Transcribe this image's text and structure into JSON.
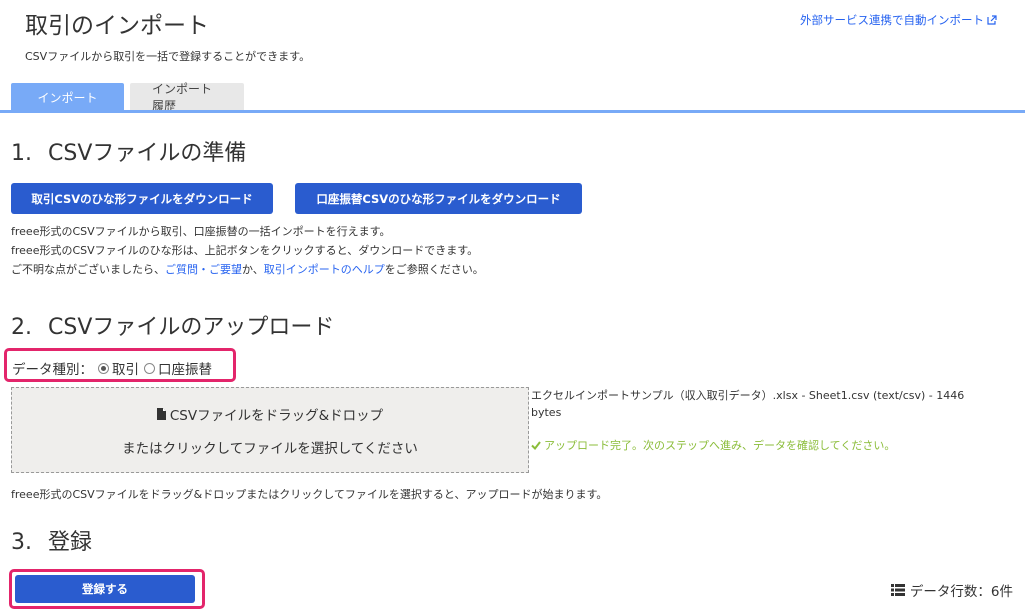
{
  "header": {
    "title": "取引のインポート",
    "subtitle": "CSVファイルから取引を一括で登録することができます。",
    "external_link": "外部サービス連携で自動インポート"
  },
  "tabs": [
    {
      "label": "インポート",
      "active": true
    },
    {
      "label": "インポート履歴",
      "active": false
    }
  ],
  "section1": {
    "number": "1.",
    "title": "CSVファイルの準備",
    "buttons": {
      "transactions": "取引CSVのひな形ファイルをダウンロード",
      "transfers": "口座振替CSVのひな形ファイルをダウンロード"
    },
    "lines": {
      "line1": "freee形式のCSVファイルから取引、口座振替の一括インポートを行えます。",
      "line2": "freee形式のCSVファイルのひな形は、上記ボタンをクリックすると、ダウンロードできます。",
      "line3_prefix": "ご不明な点がございましたら、",
      "line3_link1": "ご質問・ご要望",
      "line3_mid": "か、",
      "line3_link2": "取引インポートのヘルプ",
      "line3_suffix": "をご参照ください。"
    }
  },
  "section2": {
    "number": "2.",
    "title": "CSVファイルのアップロード",
    "data_type_label": "データ種別：",
    "options": [
      {
        "label": "取引",
        "checked": true
      },
      {
        "label": "口座振替",
        "checked": false
      }
    ],
    "dropzone": {
      "line1": "CSVファイルをドラッグ&ドロップ",
      "line2": "またはクリックしてファイルを選択してください"
    },
    "file_info": "エクセルインポートサンプル（収入取引データ）.xlsx - Sheet1.csv (text/csv) - 1446 bytes",
    "upload_status": "アップロード完了。次のステップへ進み、データを確認してください。",
    "help_text": "freee形式のCSVファイルをドラッグ&ドロップまたはクリックしてファイルを選択すると、アップロードが始まります。"
  },
  "section3": {
    "number": "3.",
    "title": "登録",
    "register_button": "登録する",
    "row_count": "データ行数：6件"
  },
  "colors": {
    "primary_button": "#2a5ccf",
    "tab_active": "#78aaf7",
    "highlight": "#e3256b",
    "success": "#8bbd3a",
    "link": "#2864f0"
  },
  "icons": [
    "external-link-icon",
    "file-icon",
    "check-icon",
    "list-icon"
  ]
}
